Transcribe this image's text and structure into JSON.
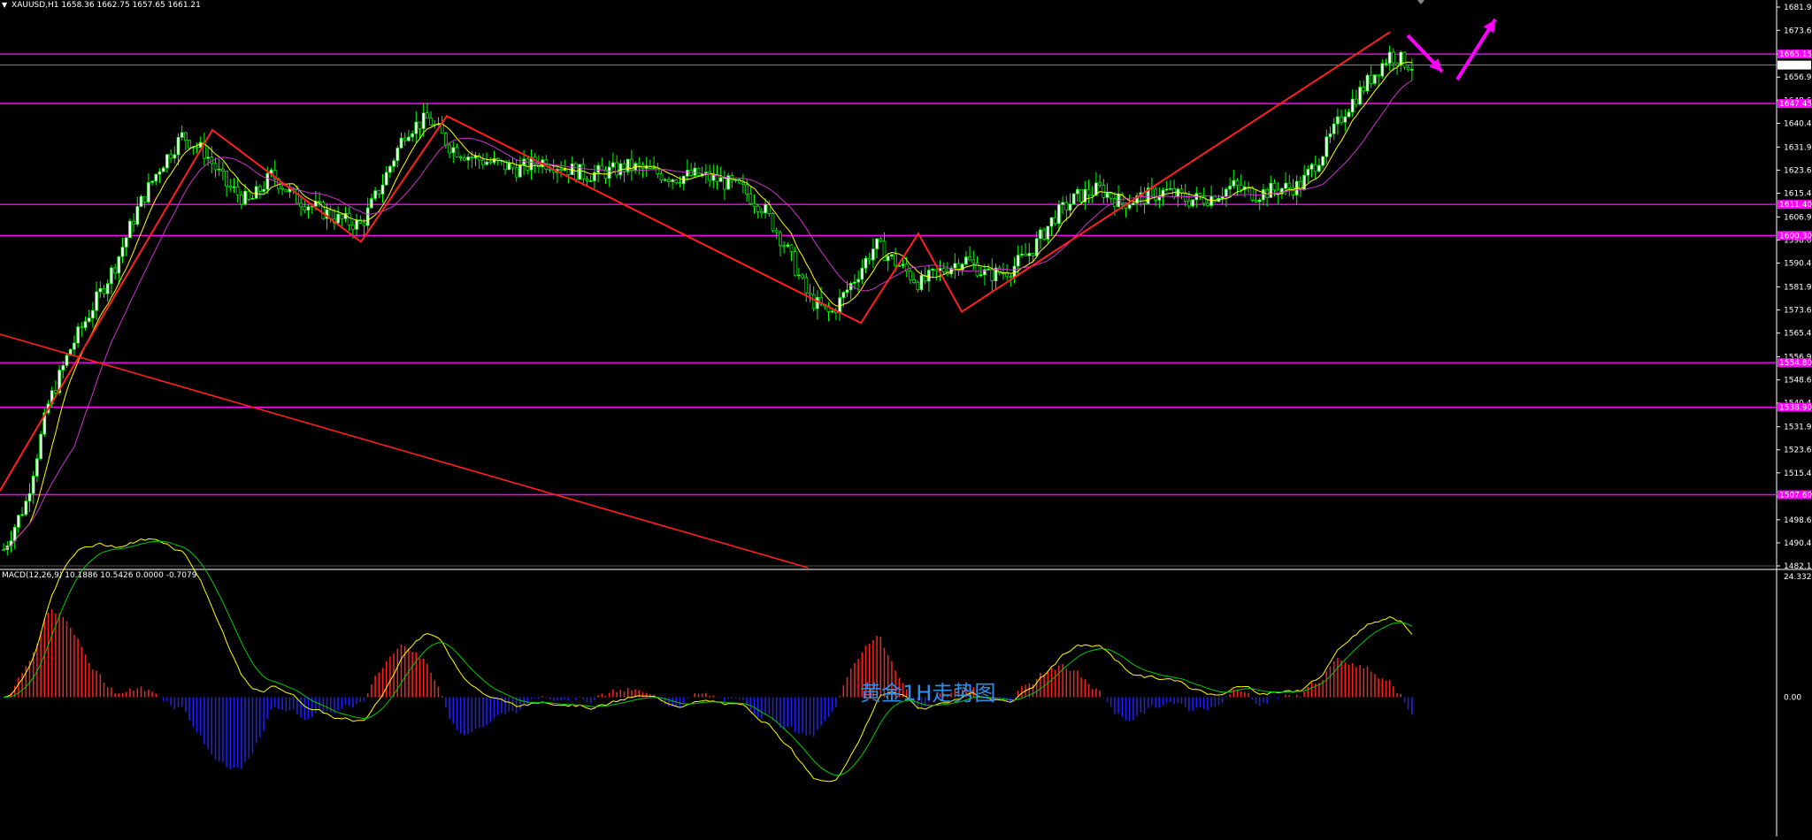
{
  "chart_header": {
    "symbol_timeframe": "XAUUSD,H1",
    "ohlc": "1658.36 1662.75 1657.65 1661.21"
  },
  "macd_header": {
    "text": "MACD(12,26,9) 10.1886 10.5426 0.0000 -0.7079"
  },
  "caption": "黄金1H走势图",
  "colors": {
    "background": "#000000",
    "bull_candle": "#ffffff",
    "bear_candle": "#000000",
    "candle_wick": "#00ff00",
    "trendline": "#ff2020",
    "hline": "#ff00ff",
    "ma_fast": "#ffff00",
    "ma_slow": "#cc33cc",
    "macd_line": "#ffff00",
    "signal_line": "#00cc00",
    "hist_pos": "#ff2020",
    "hist_neg": "#2020ff",
    "caption": "#2f8fe6",
    "arrow": "#ff00ff"
  },
  "price_axis": {
    "ticks": [
      "1681.95",
      "1673.65",
      "1665.15",
      "1656.90",
      "1648.65",
      "1640.40",
      "1631.90",
      "1623.65",
      "1615.40",
      "1606.90",
      "1598.65",
      "1590.40",
      "1581.90",
      "1573.65",
      "1565.40",
      "1556.90",
      "1548.65",
      "1540.40",
      "1531.90",
      "1523.65",
      "1515.40",
      "1506.90",
      "1498.65",
      "1490.40",
      "1482.15"
    ],
    "current_price": "1661.21"
  },
  "macd_axis": {
    "ticks": [
      "24.3324",
      "0.00"
    ]
  },
  "chart_data": {
    "type": "candlestick",
    "ylim": [
      1482.15,
      1681.95
    ],
    "horizontal_levels": [
      1665.15,
      1647.45,
      1611.4,
      1600.3,
      1554.8,
      1538.9,
      1507.6
    ],
    "level_labels": [
      "1665.15",
      "1647.45",
      "1611.40",
      "1600.30",
      "1554.80",
      "1538.90",
      "1507.60"
    ],
    "zigzag": [
      1509,
      1638,
      1598,
      1643,
      1569,
      1601,
      1573,
      1673
    ],
    "close_path": [
      1488,
      1505,
      1540,
      1560,
      1575,
      1590,
      1610,
      1625,
      1636,
      1630,
      1618,
      1612,
      1622,
      1614,
      1610,
      1606,
      1604,
      1620,
      1638,
      1642,
      1632,
      1628,
      1626,
      1624,
      1627,
      1625,
      1622,
      1623,
      1625,
      1623,
      1621,
      1622,
      1620,
      1617,
      1610,
      1596,
      1578,
      1572,
      1584,
      1597,
      1590,
      1583,
      1588,
      1592,
      1586,
      1588,
      1595,
      1607,
      1614,
      1617,
      1612,
      1614,
      1616,
      1613,
      1614,
      1618,
      1615,
      1617,
      1618,
      1630,
      1645,
      1655,
      1665,
      1661
    ],
    "macd_range": [
      -27,
      24.3324
    ]
  }
}
